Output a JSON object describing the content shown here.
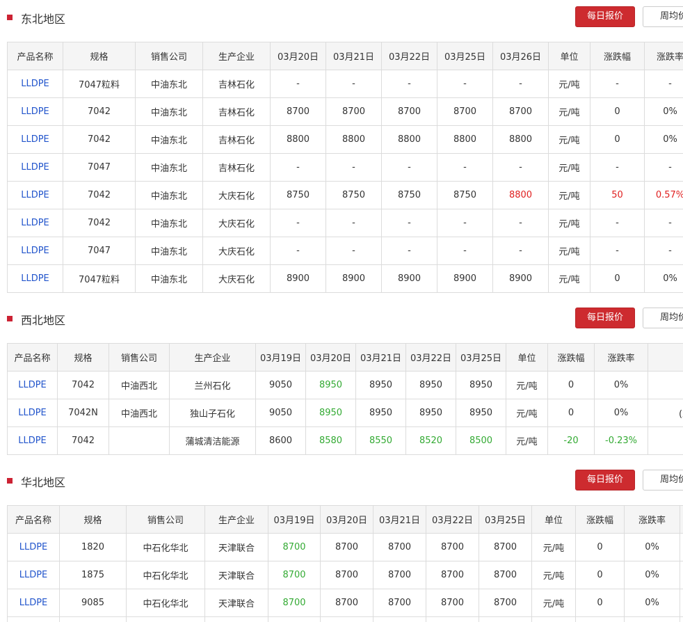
{
  "buttons": {
    "daily": "每日报价",
    "weekly": "周均价"
  },
  "northeast": {
    "title": "东北地区",
    "headers": [
      "产品名称",
      "规格",
      "销售公司",
      "生产企业",
      "03月20日",
      "03月21日",
      "03月22日",
      "03月25日",
      "03月26日",
      "单位",
      "涨跌幅",
      "涨跌率"
    ],
    "rows": [
      [
        "LLDPE",
        "7047粒料",
        "中油东北",
        "吉林石化",
        "-",
        "-",
        "-",
        "-",
        "-",
        "元/吨",
        "-",
        "-"
      ],
      [
        "LLDPE",
        "7042",
        "中油东北",
        "吉林石化",
        "8700",
        "8700",
        "8700",
        "8700",
        "8700",
        "元/吨",
        "0",
        "0%"
      ],
      [
        "LLDPE",
        "7042",
        "中油东北",
        "吉林石化",
        "8800",
        "8800",
        "8800",
        "8800",
        "8800",
        "元/吨",
        "0",
        "0%"
      ],
      [
        "LLDPE",
        "7047",
        "中油东北",
        "吉林石化",
        "-",
        "-",
        "-",
        "-",
        "-",
        "元/吨",
        "-",
        "-"
      ],
      [
        "LLDPE",
        "7042",
        "中油东北",
        "大庆石化",
        "8750",
        "8750",
        "8750",
        "8750",
        "8800",
        "元/吨",
        "50",
        "0.57%"
      ],
      [
        "LLDPE",
        "7042",
        "中油东北",
        "大庆石化",
        "-",
        "-",
        "-",
        "-",
        "-",
        "元/吨",
        "-",
        "-"
      ],
      [
        "LLDPE",
        "7047",
        "中油东北",
        "大庆石化",
        "-",
        "-",
        "-",
        "-",
        "-",
        "元/吨",
        "-",
        "-"
      ],
      [
        "LLDPE",
        "7047粒料",
        "中油东北",
        "大庆石化",
        "8900",
        "8900",
        "8900",
        "8900",
        "8900",
        "元/吨",
        "0",
        "0%"
      ]
    ],
    "colors": [
      [
        "",
        "",
        "",
        "",
        "",
        "",
        "",
        "",
        "",
        "",
        "",
        ""
      ],
      [
        "",
        "",
        "",
        "",
        "",
        "",
        "",
        "",
        "",
        "",
        "",
        ""
      ],
      [
        "",
        "",
        "",
        "",
        "",
        "",
        "",
        "",
        "",
        "",
        "",
        ""
      ],
      [
        "",
        "",
        "",
        "",
        "",
        "",
        "",
        "",
        "",
        "",
        "",
        ""
      ],
      [
        "",
        "",
        "",
        "",
        "",
        "",
        "",
        "",
        "red",
        "",
        "red",
        "red"
      ],
      [
        "",
        "",
        "",
        "",
        "",
        "",
        "",
        "",
        "",
        "",
        "",
        ""
      ],
      [
        "",
        "",
        "",
        "",
        "",
        "",
        "",
        "",
        "",
        "",
        "",
        ""
      ],
      [
        "",
        "",
        "",
        "",
        "",
        "",
        "",
        "",
        "",
        "",
        "",
        ""
      ]
    ]
  },
  "northwest": {
    "title": "西北地区",
    "headers": [
      "产品名称",
      "规格",
      "销售公司",
      "生产企业",
      "03月19日",
      "03月20日",
      "03月21日",
      "03月22日",
      "03月25日",
      "单位",
      "涨跌幅",
      "涨跌率",
      ""
    ],
    "rows": [
      [
        "LLDPE",
        "7042",
        "中油西北",
        "兰州石化",
        "9050",
        "8950",
        "8950",
        "8950",
        "8950",
        "元/吨",
        "0",
        "0%",
        ""
      ],
      [
        "LLDPE",
        "7042N",
        "中油西北",
        "独山子石化",
        "9050",
        "8950",
        "8950",
        "8950",
        "8950",
        "元/吨",
        "0",
        "0%",
        "(兰州"
      ],
      [
        "LLDPE",
        "7042",
        "",
        "蒲城清洁能源",
        "8600",
        "8580",
        "8550",
        "8520",
        "8500",
        "元/吨",
        "-20",
        "-0.23%",
        ""
      ]
    ],
    "colors": [
      [
        "",
        "",
        "",
        "",
        "",
        "green",
        "",
        "",
        "",
        "",
        "",
        "",
        ""
      ],
      [
        "",
        "",
        "",
        "",
        "",
        "green",
        "",
        "",
        "",
        "",
        "",
        "",
        ""
      ],
      [
        "",
        "",
        "",
        "",
        "",
        "green",
        "green",
        "green",
        "green",
        "",
        "green",
        "green",
        ""
      ]
    ]
  },
  "north": {
    "title": "华北地区",
    "headers": [
      "产品名称",
      "规格",
      "销售公司",
      "生产企业",
      "03月19日",
      "03月20日",
      "03月21日",
      "03月22日",
      "03月25日",
      "单位",
      "涨跌幅",
      "涨跌率",
      ""
    ],
    "rows": [
      [
        "LLDPE",
        "1820",
        "中石化华北",
        "天津联合",
        "8700",
        "8700",
        "8700",
        "8700",
        "8700",
        "元/吨",
        "0",
        "0%",
        ""
      ],
      [
        "LLDPE",
        "1875",
        "中石化华北",
        "天津联合",
        "8700",
        "8700",
        "8700",
        "8700",
        "8700",
        "元/吨",
        "0",
        "0%",
        ""
      ],
      [
        "LLDPE",
        "9085",
        "中石化华北",
        "天津联合",
        "8700",
        "8700",
        "8700",
        "8700",
        "8700",
        "元/吨",
        "0",
        "0%",
        ""
      ],
      [
        "",
        "",
        "",
        "",
        "",
        "",
        "",
        "",
        "",
        "",
        "",
        "",
        ""
      ]
    ],
    "colors": [
      [
        "",
        "",
        "",
        "",
        "green",
        "",
        "",
        "",
        "",
        "",
        "",
        "",
        ""
      ],
      [
        "",
        "",
        "",
        "",
        "green",
        "",
        "",
        "",
        "",
        "",
        "",
        "",
        ""
      ],
      [
        "",
        "",
        "",
        "",
        "green",
        "",
        "",
        "",
        "",
        "",
        "",
        "",
        ""
      ],
      [
        "",
        "",
        "",
        "",
        "",
        "",
        "",
        "",
        "",
        "",
        "",
        "",
        ""
      ]
    ]
  },
  "accent_colors": {
    "red_button": "#cd2b2f",
    "rise": "#e02020",
    "fall": "#33aa33",
    "link": "#2255cc"
  }
}
